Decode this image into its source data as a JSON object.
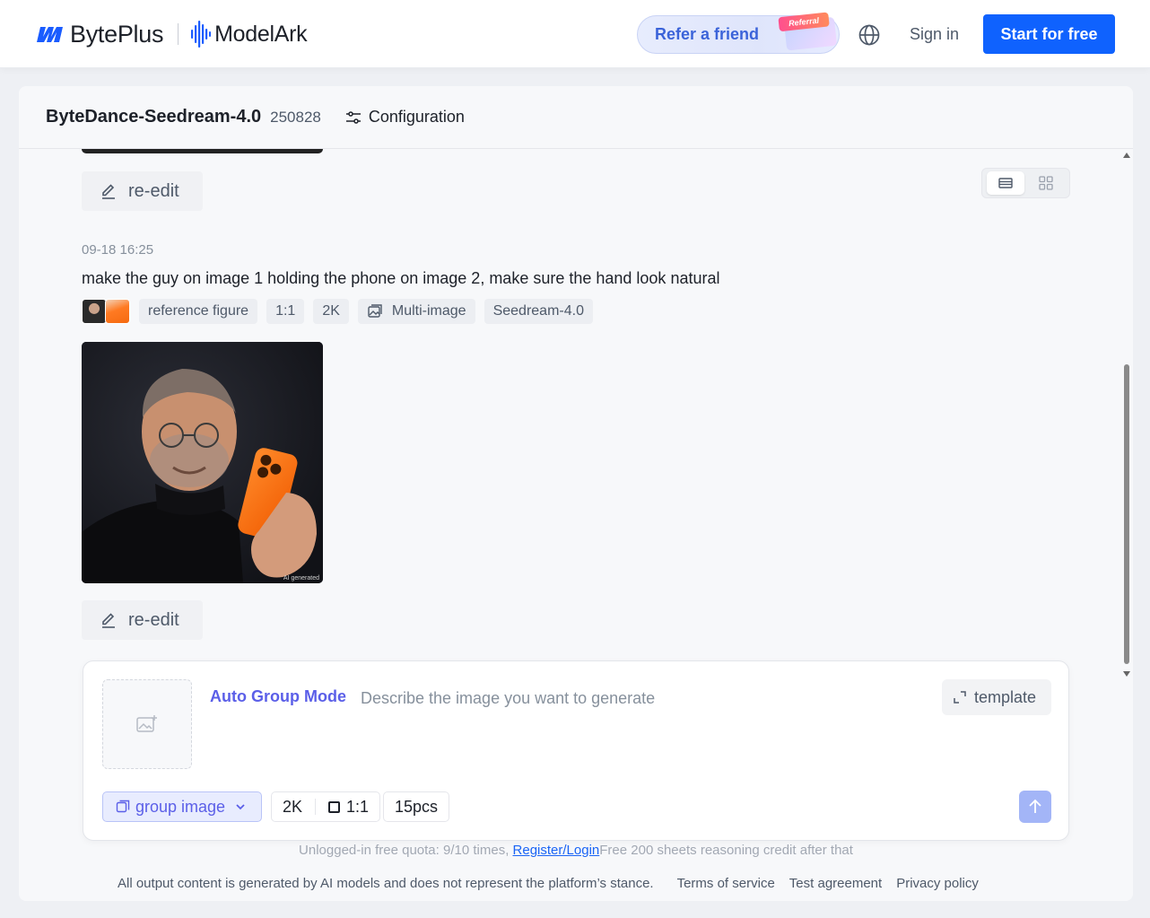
{
  "header": {
    "brand_primary": "BytePlus",
    "brand_secondary": "ModelArk",
    "refer_label": "Refer a friend",
    "referral_badge": "Referral",
    "signin_label": "Sign in",
    "start_label": "Start for free",
    "globe_icon": "globe-icon"
  },
  "model": {
    "name": "ByteDance-Seedream-4.0",
    "version": "250828",
    "config_label": "Configuration"
  },
  "history": {
    "reedit_label": "re-edit",
    "timestamp": "09-18 16:25",
    "prompt": "make the guy on image 1 holding the phone on image 2, make sure the hand look natural",
    "tags": {
      "reference": "reference figure",
      "ratio": "1:1",
      "resolution": "2K",
      "mode": "Multi-image",
      "model": "Seedream-4.0"
    },
    "image_label": "AI generated"
  },
  "composer": {
    "mode_label": "Auto Group Mode",
    "placeholder": "Describe the image you want to generate",
    "template_label": "template",
    "group_label": "group image",
    "resolution": "2K",
    "ratio": "1:1",
    "count": "15pcs"
  },
  "quota": {
    "text": "Unlogged-in free quota: 9/10 times,",
    "link": "Register/Login",
    "tail": "Free 200 sheets reasoning credit after that"
  },
  "footer": {
    "disclaimer": "All output content is generated by AI models and does not represent the platform’s stance.",
    "terms": "Terms of service",
    "test": "Test agreement",
    "privacy": "Privacy policy"
  },
  "colors": {
    "primary": "#0f62fe",
    "accent": "#5b5fe8",
    "phone": "#ff6a13"
  }
}
